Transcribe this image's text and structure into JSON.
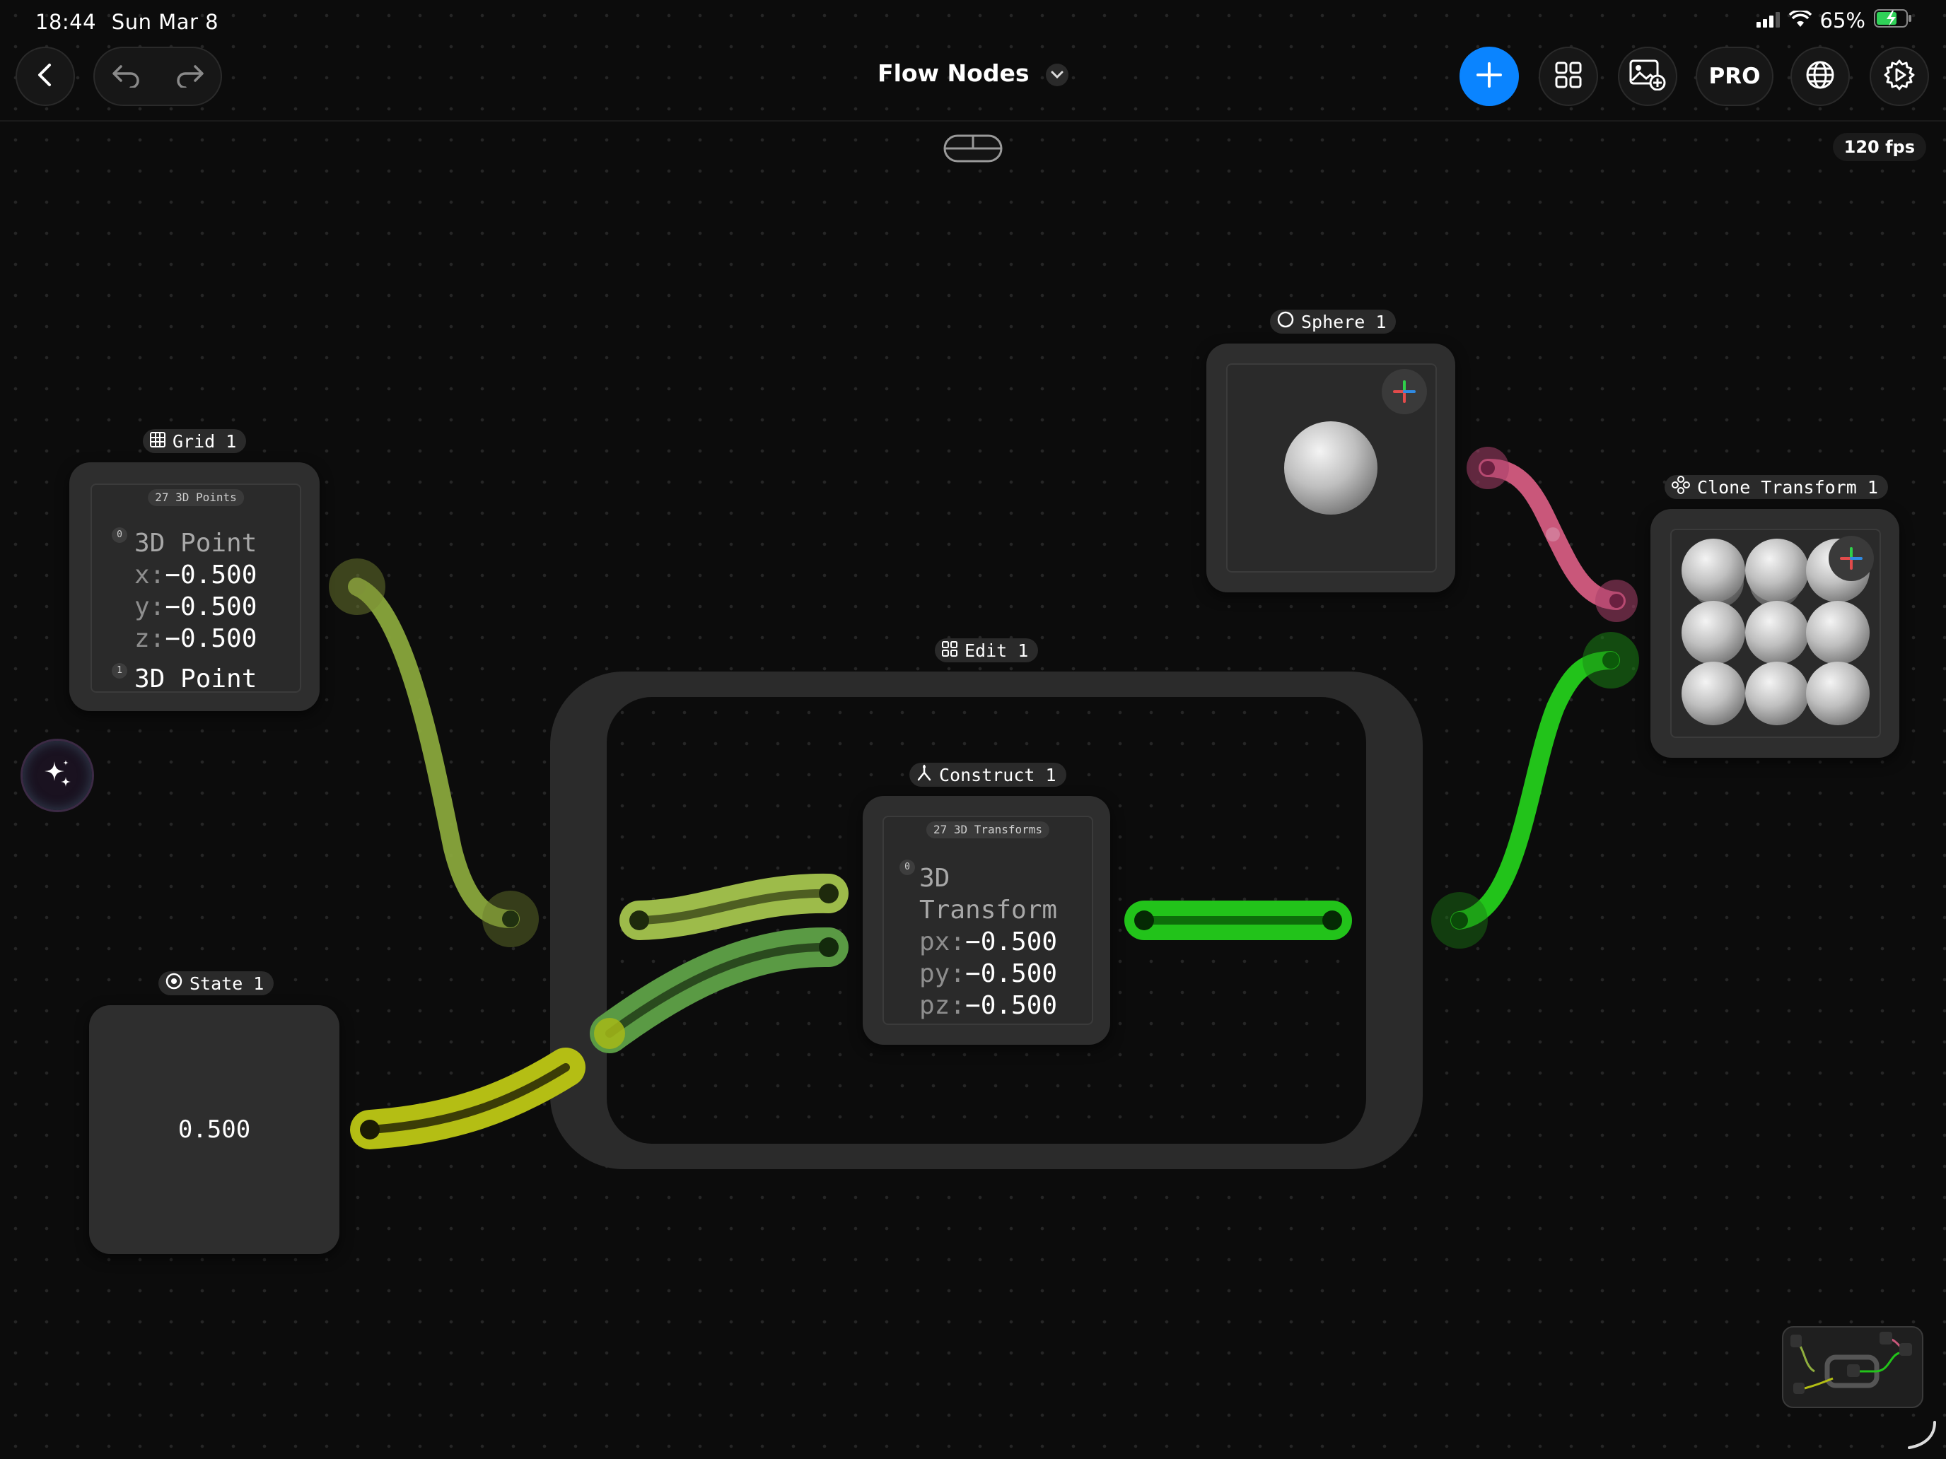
{
  "status_bar": {
    "time": "18:44",
    "date": "Sun Mar 8",
    "battery": "65%"
  },
  "toolbar": {
    "title": "Flow Nodes",
    "fps": "120 fps",
    "pro_label": "PRO",
    "accent_color": "#0a84ff"
  },
  "nodes": {
    "grid": {
      "label": "Grid 1",
      "count": "27 3D Points",
      "items": [
        {
          "index": "0",
          "type": "3D Point",
          "x_key": "x:",
          "x": "−0.500",
          "y_key": "y:",
          "y": "−0.500",
          "z_key": "z:",
          "z": "−0.500"
        },
        {
          "index": "1",
          "type": "3D Point"
        }
      ]
    },
    "state": {
      "label": "State 1",
      "value": "0.500"
    },
    "edit": {
      "label": "Edit 1"
    },
    "construct": {
      "label": "Construct 1",
      "count": "27 3D Transforms",
      "items": [
        {
          "index": "0",
          "type_line1": "3D",
          "type_line2": "Transform",
          "px_key": "px:",
          "px": "−0.500",
          "py_key": "py:",
          "py": "−0.500",
          "pz_key": "pz:",
          "pz": "−0.500"
        }
      ]
    },
    "sphere": {
      "label": "Sphere 1"
    },
    "clone": {
      "label": "Clone Transform 1"
    }
  },
  "wire_colors": {
    "grid": "#8fae3e",
    "state": "#b4be14",
    "construct_input_a": "#9dbb4a",
    "construct_input_b": "#5a9a44",
    "output": "#22c31a",
    "sphere": "#c9577a"
  }
}
